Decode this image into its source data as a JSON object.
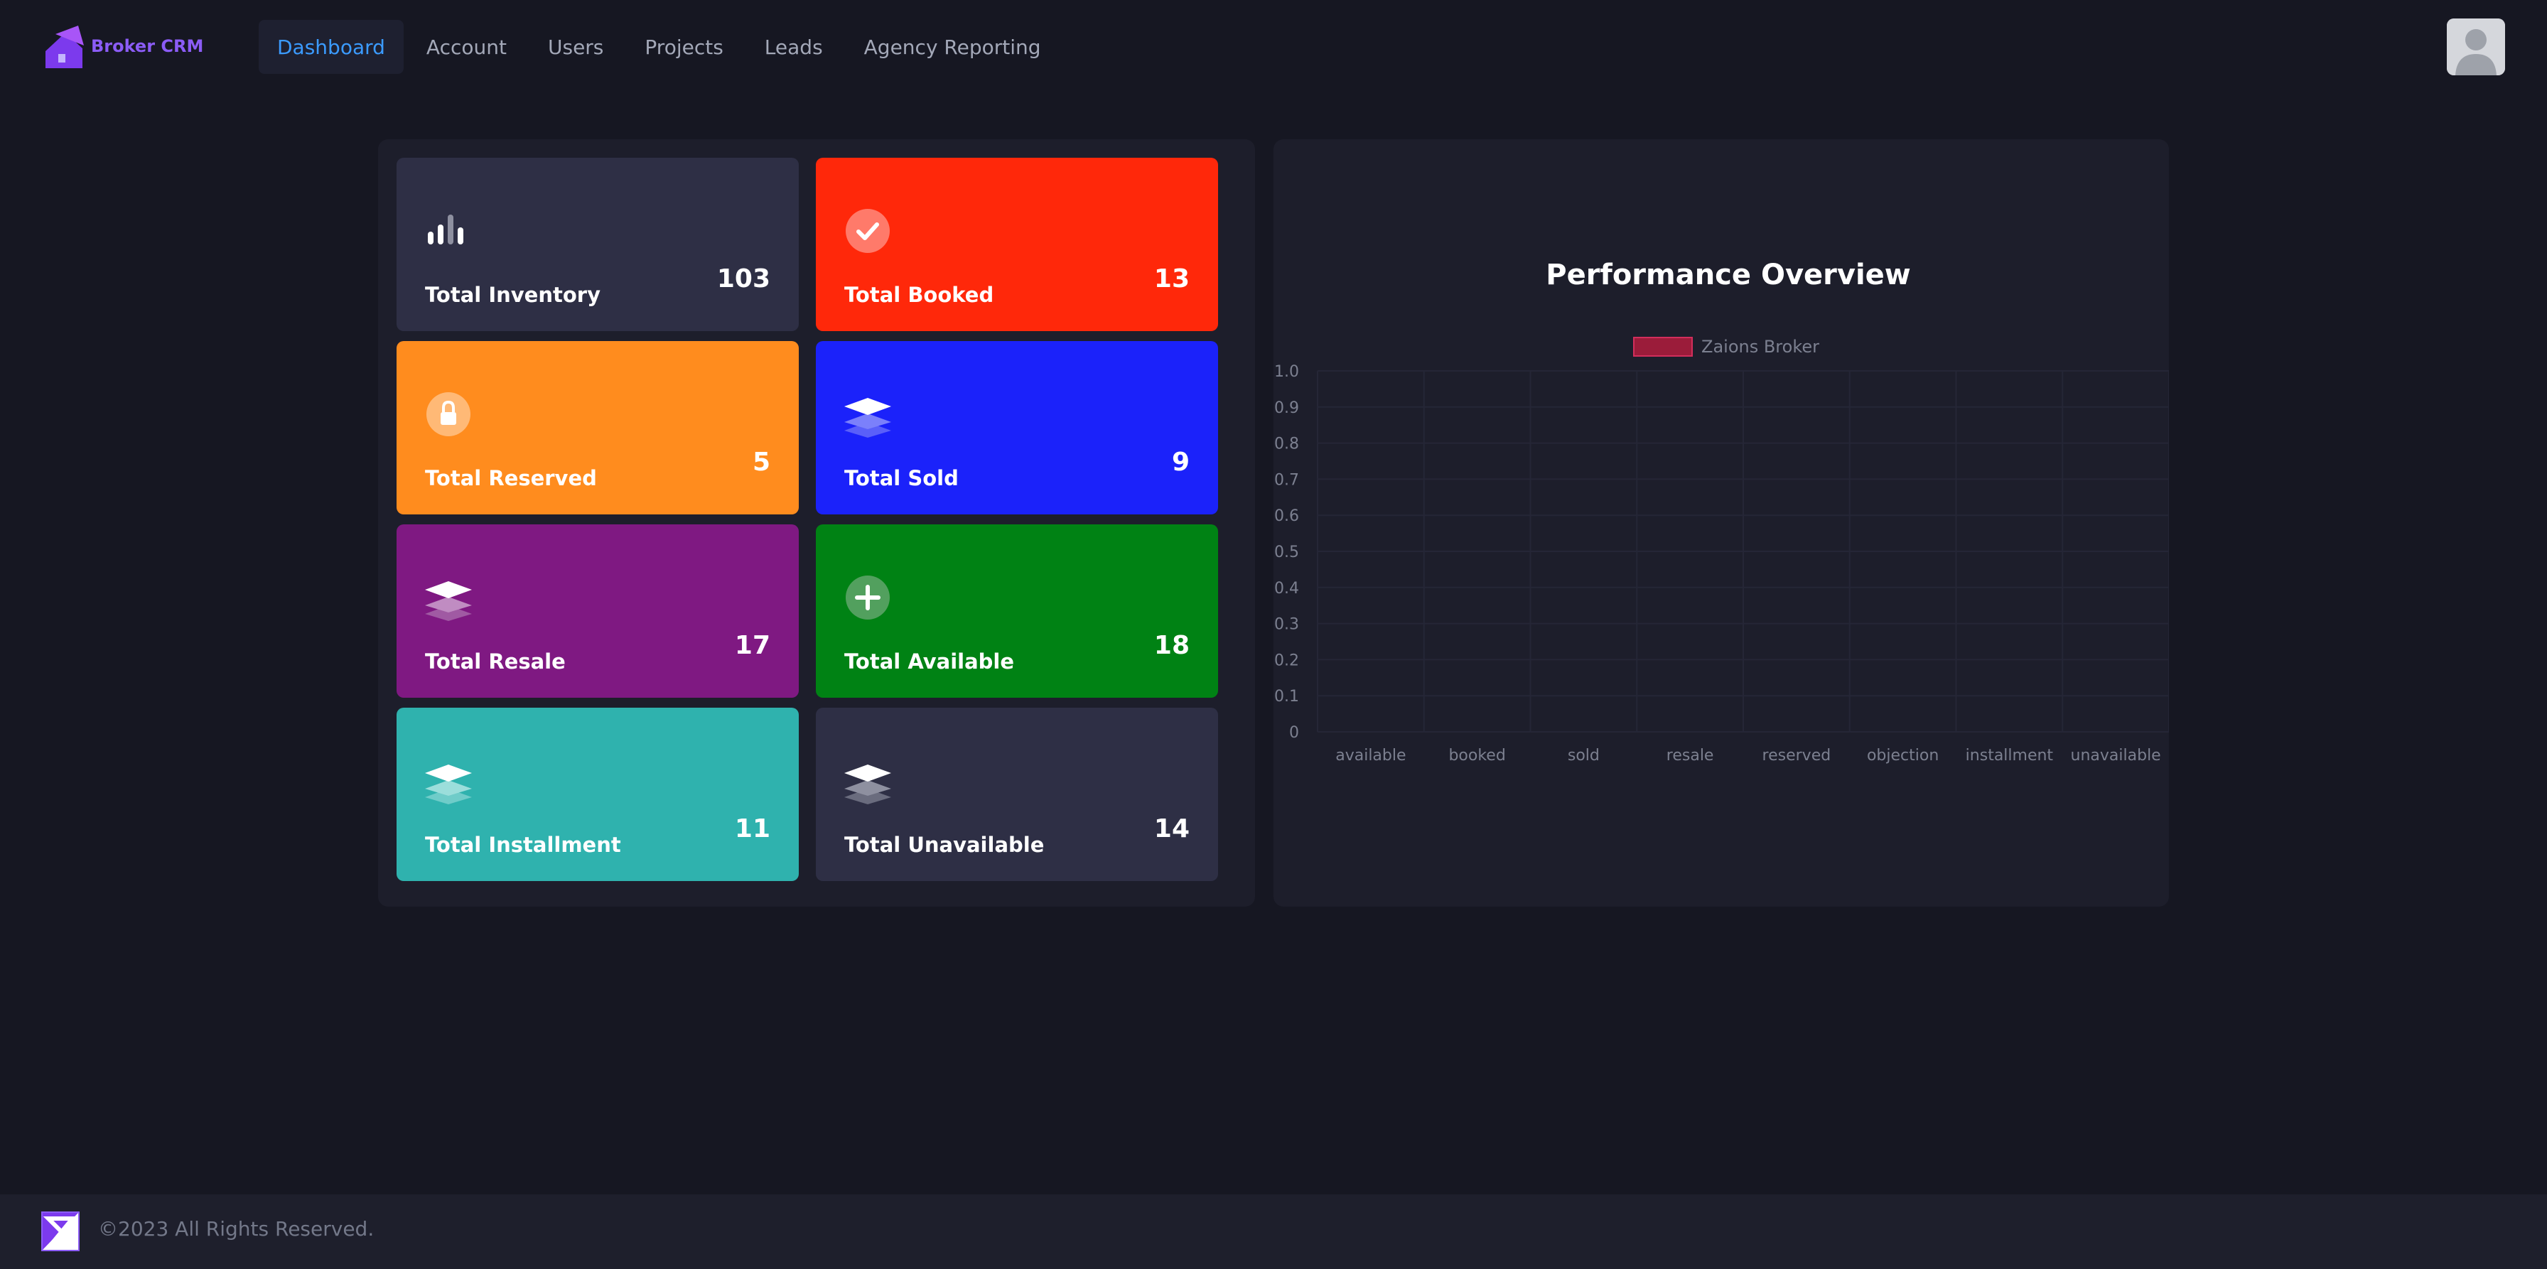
{
  "brand": {
    "name": "Broker CRM",
    "logo_color": "#8b5cf6"
  },
  "nav": {
    "items": [
      {
        "label": "Dashboard",
        "active": true
      },
      {
        "label": "Account",
        "active": false
      },
      {
        "label": "Users",
        "active": false
      },
      {
        "label": "Projects",
        "active": false
      },
      {
        "label": "Leads",
        "active": false
      },
      {
        "label": "Agency Reporting",
        "active": false
      }
    ]
  },
  "cards": [
    {
      "label": "Total Inventory",
      "value": "103",
      "icon": "bar-chart-icon",
      "color": "#2e2f45"
    },
    {
      "label": "Total Booked",
      "value": "13",
      "icon": "check-circle-icon",
      "color": "#ff280a"
    },
    {
      "label": "Total Reserved",
      "value": "5",
      "icon": "lock-icon",
      "color": "#ff8c1e"
    },
    {
      "label": "Total Sold",
      "value": "9",
      "icon": "layers-icon",
      "color": "#1b22fa"
    },
    {
      "label": "Total Resale",
      "value": "17",
      "icon": "layers-icon",
      "color": "#7f1982"
    },
    {
      "label": "Total Available",
      "value": "18",
      "icon": "plus-circle-icon",
      "color": "#008214"
    },
    {
      "label": "Total Installment",
      "value": "11",
      "icon": "layers-icon",
      "color": "#2fb2ae"
    },
    {
      "label": "Total Unavailable",
      "value": "14",
      "icon": "layers-icon",
      "color": "#2e2f45"
    }
  ],
  "chart_data": {
    "type": "bar",
    "title": "Performance Overview",
    "categories": [
      "available",
      "booked",
      "sold",
      "resale",
      "reserved",
      "objection",
      "installment",
      "unavailable"
    ],
    "series": [
      {
        "name": "Zaions Broker",
        "values": [
          0,
          0,
          0,
          0,
          0,
          0,
          0,
          0
        ],
        "color": "#9b1c3a"
      }
    ],
    "ylim": [
      0,
      1.0
    ],
    "yticks": [
      "0",
      "0.1",
      "0.2",
      "0.3",
      "0.4",
      "0.5",
      "0.6",
      "0.7",
      "0.8",
      "0.9",
      "1.0"
    ],
    "legend": "top",
    "grid": true
  },
  "footer": {
    "copyright": "©2023 All Rights Reserved."
  }
}
